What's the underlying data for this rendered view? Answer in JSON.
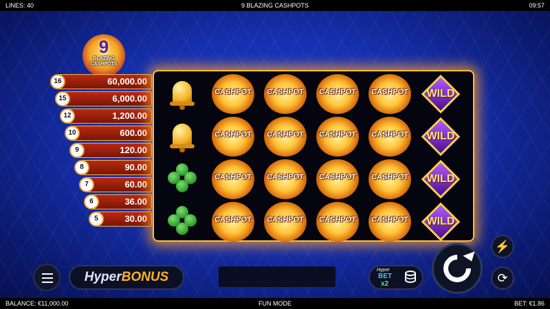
{
  "status": {
    "lines": "LINES: 40",
    "game_title": "9 BLAZING CASHPOTS",
    "time": "09:57"
  },
  "footer": {
    "balance": "BALANCE: €11,000.00",
    "mode": "FUN MODE",
    "bet": "BET: €1.86"
  },
  "logo": {
    "number": "9",
    "text_line1": "BLAZING",
    "text_line2": "CASHPOTS"
  },
  "paytable": [
    {
      "count": "16",
      "amount": "60,000.00"
    },
    {
      "count": "15",
      "amount": "6,000.00"
    },
    {
      "count": "12",
      "amount": "1,200.00"
    },
    {
      "count": "10",
      "amount": "600.00"
    },
    {
      "count": "9",
      "amount": "120.00"
    },
    {
      "count": "8",
      "amount": "90.00"
    },
    {
      "count": "7",
      "amount": "60.00"
    },
    {
      "count": "6",
      "amount": "36.00"
    },
    {
      "count": "5",
      "amount": "30.00"
    }
  ],
  "symbols": {
    "cashpot_label": "CASHPOT",
    "wild_label": "WILD",
    "grid": [
      [
        "bell",
        "cashpot",
        "cashpot",
        "cashpot",
        "cashpot",
        "wild"
      ],
      [
        "bell",
        "cashpot",
        "cashpot",
        "cashpot",
        "cashpot",
        "wild"
      ],
      [
        "clover",
        "cashpot",
        "cashpot",
        "cashpot",
        "cashpot",
        "wild"
      ],
      [
        "clover",
        "cashpot",
        "cashpot",
        "cashpot",
        "cashpot",
        "wild"
      ]
    ]
  },
  "controls": {
    "menu_icon": "hamburger-icon",
    "hyper_bonus_part1": "Hyper",
    "hyper_bonus_part2": "BONUS",
    "hyper_bet_line1": "Hyper",
    "hyper_bet_line2": "BET",
    "hyper_bet_multiplier": "x2",
    "spin_icon": "spin-arrow-icon",
    "turbo_icon": "lightning-icon",
    "autoplay_icon": "autoplay-icon"
  },
  "colors": {
    "background": "#1630b0",
    "frame_glow": "#ffbf3a",
    "paytable_red": "#b82a12",
    "bonus_orange": "#ffb21e"
  }
}
